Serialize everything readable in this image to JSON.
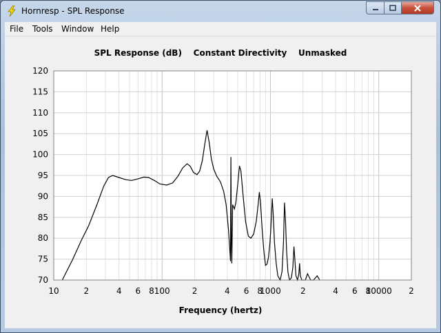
{
  "window": {
    "title": "Hornresp - SPL Response",
    "icon": "lightning-icon",
    "controls": [
      "minimize-icon",
      "maximize-icon",
      "close-icon"
    ]
  },
  "menu": [
    "File",
    "Tools",
    "Window",
    "Help"
  ],
  "chart_data": {
    "type": "line",
    "title": "SPL Response (dB)    Constant Directivity    Unmasked",
    "xlabel": "Frequency (hertz)",
    "ylabel": "",
    "x_scale": "log",
    "xlim": [
      10,
      20000
    ],
    "ylim": [
      70,
      120
    ],
    "y_ticks": [
      70,
      75,
      80,
      85,
      90,
      95,
      100,
      105,
      110,
      115,
      120
    ],
    "x_ticks": [
      {
        "v": 10,
        "label": "10"
      },
      {
        "v": 20,
        "label": "2"
      },
      {
        "v": 40,
        "label": "4"
      },
      {
        "v": 60,
        "label": "6"
      },
      {
        "v": 80,
        "label": "8"
      },
      {
        "v": 100,
        "label": "100"
      },
      {
        "v": 200,
        "label": "2"
      },
      {
        "v": 400,
        "label": "4"
      },
      {
        "v": 600,
        "label": "6"
      },
      {
        "v": 800,
        "label": "8"
      },
      {
        "v": 1000,
        "label": "1000"
      },
      {
        "v": 2000,
        "label": "2"
      },
      {
        "v": 4000,
        "label": "4"
      },
      {
        "v": 6000,
        "label": "6"
      },
      {
        "v": 8000,
        "label": "8"
      },
      {
        "v": 10000,
        "label": "10000"
      },
      {
        "v": 20000,
        "label": "2"
      }
    ],
    "grid": true,
    "series": [
      {
        "name": "",
        "color": "#000000",
        "points": [
          [
            12,
            70
          ],
          [
            15,
            75
          ],
          [
            18,
            79.5
          ],
          [
            21,
            83
          ],
          [
            25,
            88
          ],
          [
            29,
            92.5
          ],
          [
            32,
            94.5
          ],
          [
            35,
            95
          ],
          [
            40,
            94.5
          ],
          [
            46,
            94
          ],
          [
            52,
            93.8
          ],
          [
            60,
            94.2
          ],
          [
            68,
            94.6
          ],
          [
            75,
            94.5
          ],
          [
            85,
            93.8
          ],
          [
            95,
            93
          ],
          [
            110,
            92.7
          ],
          [
            125,
            93.2
          ],
          [
            140,
            94.8
          ],
          [
            155,
            96.8
          ],
          [
            170,
            97.8
          ],
          [
            182,
            97.2
          ],
          [
            195,
            95.7
          ],
          [
            210,
            95.2
          ],
          [
            222,
            96
          ],
          [
            235,
            98.5
          ],
          [
            248,
            102.5
          ],
          [
            260,
            105.8
          ],
          [
            272,
            103
          ],
          [
            285,
            99
          ],
          [
            300,
            96.5
          ],
          [
            320,
            94.8
          ],
          [
            345,
            93.5
          ],
          [
            370,
            91.2
          ],
          [
            390,
            88
          ],
          [
            410,
            82
          ],
          [
            420,
            78
          ],
          [
            428,
            74.5
          ],
          [
            432,
            99.4
          ],
          [
            436,
            79
          ],
          [
            440,
            74
          ],
          [
            448,
            88
          ],
          [
            465,
            87
          ],
          [
            480,
            88.5
          ],
          [
            500,
            93
          ],
          [
            518,
            97.3
          ],
          [
            535,
            96
          ],
          [
            560,
            90
          ],
          [
            590,
            84
          ],
          [
            625,
            80.5
          ],
          [
            660,
            80
          ],
          [
            700,
            81
          ],
          [
            740,
            84
          ],
          [
            770,
            88
          ],
          [
            790,
            91
          ],
          [
            810,
            88.5
          ],
          [
            840,
            82
          ],
          [
            870,
            77
          ],
          [
            900,
            73.5
          ],
          [
            930,
            73.8
          ],
          [
            960,
            75.5
          ],
          [
            990,
            79
          ],
          [
            1010,
            82.5
          ],
          [
            1040,
            89.5
          ],
          [
            1060,
            86
          ],
          [
            1090,
            79
          ],
          [
            1130,
            74
          ],
          [
            1170,
            71
          ],
          [
            1230,
            70
          ],
          [
            1280,
            72
          ],
          [
            1320,
            79
          ],
          [
            1350,
            88.5
          ],
          [
            1380,
            84
          ],
          [
            1410,
            77
          ],
          [
            1450,
            72
          ],
          [
            1500,
            70
          ],
          [
            1560,
            70.5
          ],
          [
            1610,
            73
          ],
          [
            1650,
            78
          ],
          [
            1680,
            75
          ],
          [
            1720,
            71
          ],
          [
            1780,
            70
          ],
          [
            1830,
            71.5
          ],
          [
            1860,
            74
          ],
          [
            1890,
            71
          ],
          [
            1950,
            70
          ],
          [
            2100,
            70
          ],
          [
            2200,
            71.5
          ],
          [
            2350,
            70
          ],
          [
            2500,
            70
          ],
          [
            2700,
            71
          ],
          [
            2850,
            70
          ]
        ]
      }
    ]
  }
}
